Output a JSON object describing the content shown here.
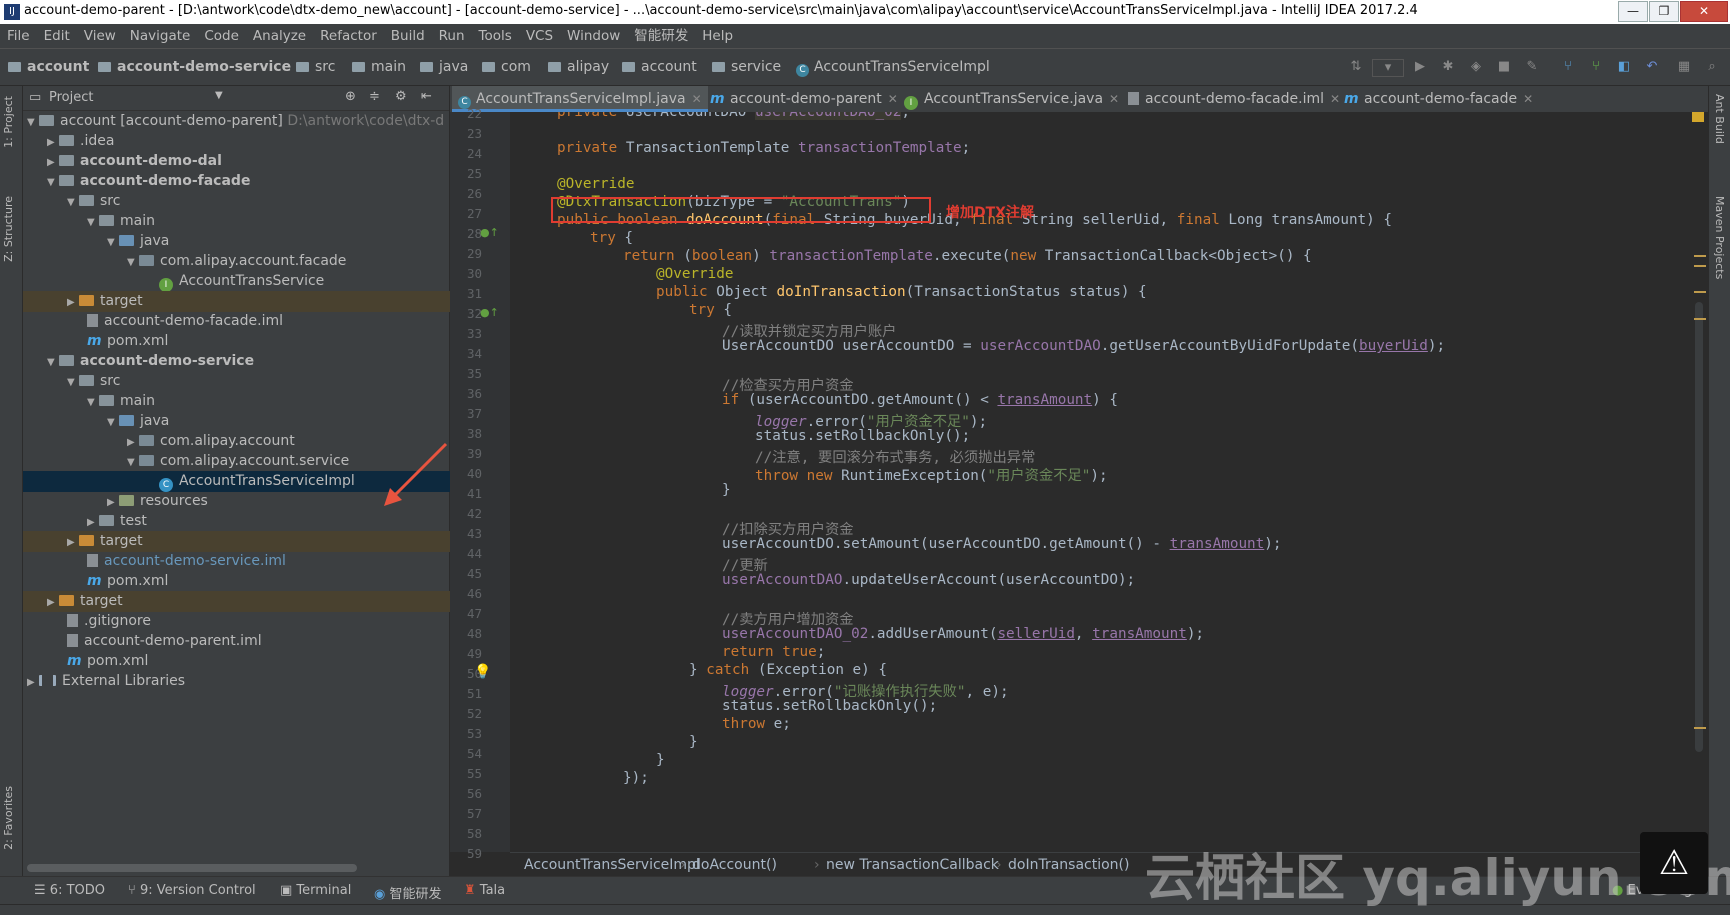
{
  "window": {
    "title": "account-demo-parent - [D:\\antwork\\code\\dtx-demo_new\\account] - [account-demo-service] - ...\\account-demo-service\\src\\main\\java\\com\\alipay\\account\\service\\AccountTransServiceImpl.java - IntelliJ IDEA 2017.2.4",
    "app_icon": "IJ",
    "minimize": "—",
    "maximize": "❐",
    "close": "✕"
  },
  "menu": [
    "File",
    "Edit",
    "View",
    "Navigate",
    "Code",
    "Analyze",
    "Refactor",
    "Build",
    "Run",
    "Tools",
    "VCS",
    "Window",
    "智能研发",
    "Help"
  ],
  "navbar": {
    "crumbs": [
      "account",
      "account-demo-service",
      "src",
      "main",
      "java",
      "com",
      "alipay",
      "account",
      "service",
      "AccountTransServiceImpl"
    ]
  },
  "project_panel": {
    "title": "Project",
    "rows": [
      {
        "text": "account [account-demo-parent]",
        "suffix": "D:\\antwork\\code\\dtx-d"
      },
      {
        "text": ".idea"
      },
      {
        "text": "account-demo-dal"
      },
      {
        "text": "account-demo-facade"
      },
      {
        "text": "src"
      },
      {
        "text": "main"
      },
      {
        "text": "java"
      },
      {
        "text": "com.alipay.account.facade"
      },
      {
        "text": "AccountTransService"
      },
      {
        "text": "target"
      },
      {
        "text": "account-demo-facade.iml"
      },
      {
        "text": "pom.xml"
      },
      {
        "text": "account-demo-service"
      },
      {
        "text": "src"
      },
      {
        "text": "main"
      },
      {
        "text": "java"
      },
      {
        "text": "com.alipay.account"
      },
      {
        "text": "com.alipay.account.service"
      },
      {
        "text": "AccountTransServiceImpl"
      },
      {
        "text": "resources"
      },
      {
        "text": "test"
      },
      {
        "text": "target"
      },
      {
        "text": "account-demo-service.iml"
      },
      {
        "text": "pom.xml"
      },
      {
        "text": "target"
      },
      {
        "text": ".gitignore"
      },
      {
        "text": "account-demo-parent.iml"
      },
      {
        "text": "pom.xml"
      },
      {
        "text": "External Libraries"
      }
    ]
  },
  "left_tabs": [
    "1: Project",
    "Z: Structure",
    "2: Favorites"
  ],
  "right_tabs": [
    "Ant Build",
    "Maven Projects"
  ],
  "editor_tabs": [
    "AccountTransServiceImpl.java",
    "account-demo-parent",
    "AccountTransService.java",
    "account-demo-facade.iml",
    "account-demo-facade"
  ],
  "code_lines": {
    "l22": "22",
    "l23": "23",
    "l24": "24",
    "l25": "25",
    "l26": "26",
    "l27": "27",
    "l28": "28",
    "l29": "29",
    "l30": "30",
    "l31": "31",
    "l32": "32",
    "l33": "33",
    "l34": "34",
    "l35": "35",
    "l36": "36",
    "l37": "37",
    "l38": "38",
    "l39": "39",
    "l40": "40",
    "l41": "41",
    "l42": "42",
    "l43": "43",
    "l44": "44",
    "l45": "45",
    "l46": "46",
    "l47": "47",
    "l48": "48",
    "l49": "49",
    "l50": "50",
    "l51": "51",
    "l52": "52",
    "l53": "53",
    "l54": "54",
    "l55": "55",
    "l56": "56",
    "l57": "57",
    "l58": "58",
    "l59": "59"
  },
  "code": {
    "c34": "//读取并锁定买方用户账户",
    "c37": "//检查买方用户资金",
    "c39str": "\"用户资金不足\"",
    "c41": "//注意, 要回滚分布式事务, 必须抛出异常",
    "c42str": "\"用户资金不足\"",
    "c45": "//扣除买方用户资金",
    "c47": "//更新",
    "c50": "//卖方用户增加资金",
    "c54str": "\"记账操作执行失败\"",
    "c27str": "\"AccountTrans\""
  },
  "annotation_label": "增加DTX注解",
  "editor_breadcrumb": [
    "AccountTransServiceImpl",
    "doAccount()",
    "new TransactionCallback",
    "doInTransaction()"
  ],
  "bottom_tabs": [
    "6: TODO",
    "9: Version Control",
    "Terminal",
    "智能研发",
    "Tala",
    "Event Log"
  ],
  "watermark": "云栖社区 yq.aliyun.com",
  "colors": {
    "accent": "#4a88c7",
    "annotation_red": "#e03c31"
  }
}
